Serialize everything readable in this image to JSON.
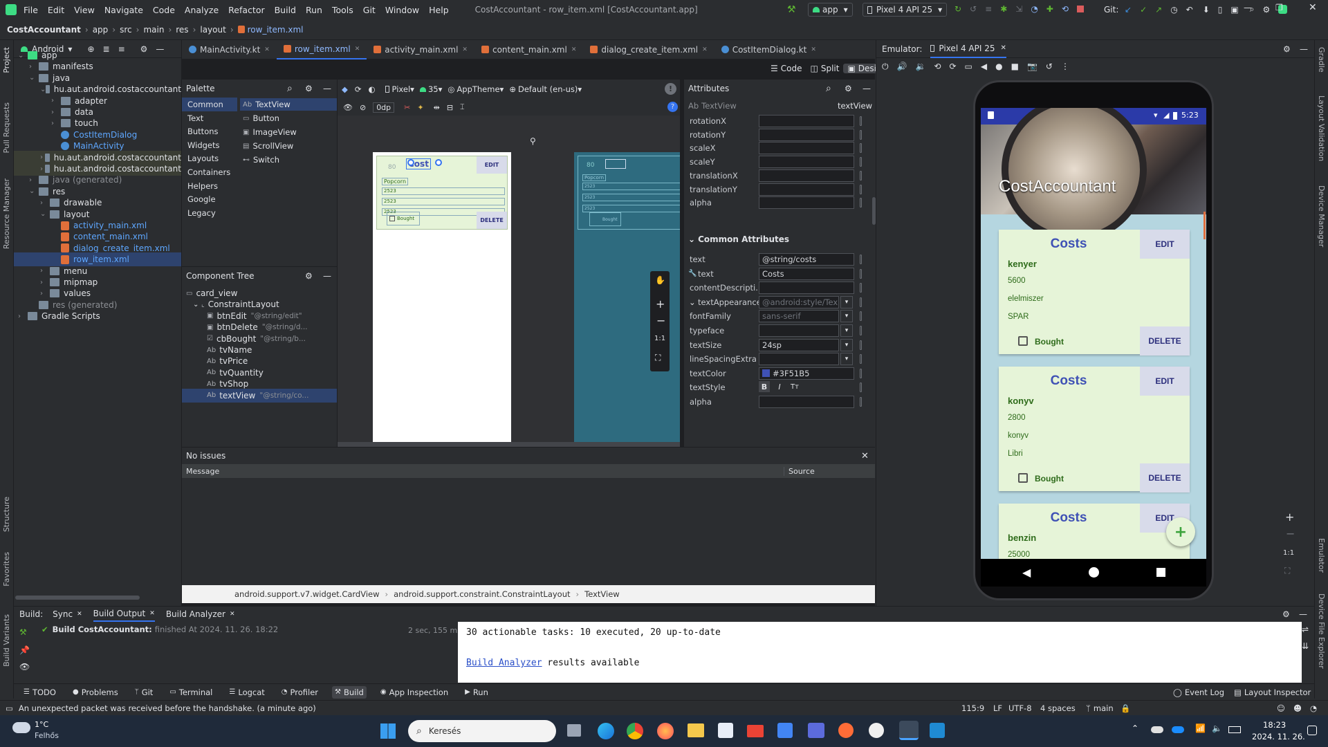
{
  "titlebar": {
    "menu": [
      "File",
      "Edit",
      "View",
      "Navigate",
      "Code",
      "Analyze",
      "Refactor",
      "Build",
      "Run",
      "Tools",
      "Git",
      "Window",
      "Help"
    ],
    "title": "CostAccountant - row_item.xml [CostAccountant.app]",
    "run_config": "app",
    "device": "Pixel 4 API 25",
    "git_label": "Git:"
  },
  "breadcrumb": [
    "CostAccountant",
    "app",
    "src",
    "main",
    "res",
    "layout",
    "row_item.xml"
  ],
  "project": {
    "view": "Android",
    "items": [
      {
        "label": "app",
        "depth": 0
      },
      {
        "label": "manifests",
        "depth": 1
      },
      {
        "label": "java",
        "depth": 1
      },
      {
        "label": "hu.aut.android.costaccountant",
        "depth": 2
      },
      {
        "label": "adapter",
        "depth": 3
      },
      {
        "label": "data",
        "depth": 3
      },
      {
        "label": "touch",
        "depth": 3
      },
      {
        "label": "CostItemDialog",
        "depth": 3
      },
      {
        "label": "MainActivity",
        "depth": 3
      },
      {
        "label": "hu.aut.android.costaccountant",
        "depth": 2
      },
      {
        "label": "hu.aut.android.costaccountant",
        "depth": 2
      },
      {
        "label": "java (generated)",
        "depth": 1
      },
      {
        "label": "res",
        "depth": 1
      },
      {
        "label": "drawable",
        "depth": 2
      },
      {
        "label": "layout",
        "depth": 2
      },
      {
        "label": "activity_main.xml",
        "depth": 3
      },
      {
        "label": "content_main.xml",
        "depth": 3
      },
      {
        "label": "dialog_create_item.xml",
        "depth": 3
      },
      {
        "label": "row_item.xml",
        "depth": 3
      },
      {
        "label": "menu",
        "depth": 2
      },
      {
        "label": "mipmap",
        "depth": 2
      },
      {
        "label": "values",
        "depth": 2
      },
      {
        "label": "res (generated)",
        "depth": 1
      },
      {
        "label": "Gradle Scripts",
        "depth": 0
      }
    ]
  },
  "tabs": [
    "MainActivity.kt",
    "row_item.xml",
    "activity_main.xml",
    "content_main.xml",
    "dialog_create_item.xml",
    "CostItemDialog.kt"
  ],
  "view_modes": [
    "Code",
    "Split",
    "Design"
  ],
  "palette": {
    "title": "Palette",
    "categories": [
      "Common",
      "Text",
      "Buttons",
      "Widgets",
      "Layouts",
      "Containers",
      "Helpers",
      "Google",
      "Legacy"
    ],
    "widgets": [
      "TextView",
      "Button",
      "ImageView",
      "ScrollView",
      "Switch"
    ]
  },
  "design_toolbar": {
    "device": "Pixel",
    "api": "35",
    "theme": "AppTheme",
    "locale": "Default (en-us)",
    "margin": "0dp"
  },
  "preview": {
    "title_text": "Cost",
    "edit": "EDIT",
    "delete": "DELETE",
    "name": "Popcorn",
    "value": "2523",
    "bought": "Bought",
    "margin_num": "80"
  },
  "component_tree": {
    "title": "Component Tree",
    "items": [
      {
        "label": "card_view",
        "hint": "",
        "depth": 0
      },
      {
        "label": "ConstraintLayout",
        "hint": "",
        "depth": 1
      },
      {
        "label": "btnEdit",
        "hint": "\"@string/edit\"",
        "depth": 2
      },
      {
        "label": "btnDelete",
        "hint": "\"@string/d...",
        "depth": 2
      },
      {
        "label": "cbBought",
        "hint": "\"@string/b...",
        "depth": 2
      },
      {
        "label": "tvName",
        "hint": "",
        "depth": 2
      },
      {
        "label": "tvPrice",
        "hint": "",
        "depth": 2
      },
      {
        "label": "tvQuantity",
        "hint": "",
        "depth": 2
      },
      {
        "label": "tvShop",
        "hint": "",
        "depth": 2
      },
      {
        "label": "textView",
        "hint": "\"@string/co...",
        "depth": 2
      }
    ]
  },
  "attributes": {
    "title": "Attributes",
    "widget": "TextView",
    "id": "textView",
    "transform": [
      {
        "k": "rotationX",
        "v": ""
      },
      {
        "k": "rotationY",
        "v": ""
      },
      {
        "k": "scaleX",
        "v": ""
      },
      {
        "k": "scaleY",
        "v": ""
      },
      {
        "k": "translationX",
        "v": ""
      },
      {
        "k": "translationY",
        "v": ""
      },
      {
        "k": "alpha",
        "v": ""
      }
    ],
    "section": "Common Attributes",
    "common": [
      {
        "k": "text",
        "v": "@string/costs"
      },
      {
        "k": "text",
        "v": "Costs"
      },
      {
        "k": "contentDescripti...",
        "v": ""
      },
      {
        "k": "textAppearance",
        "v": "@android:style/Tex"
      },
      {
        "k": "fontFamily",
        "v": "sans-serif"
      },
      {
        "k": "typeface",
        "v": ""
      },
      {
        "k": "textSize",
        "v": "24sp"
      },
      {
        "k": "lineSpacingExtra",
        "v": ""
      },
      {
        "k": "textColor",
        "v": "#3F51B5"
      },
      {
        "k": "textStyle",
        "v": ""
      },
      {
        "k": "alpha",
        "v": ""
      }
    ]
  },
  "issues": {
    "title": "No issues",
    "col_message": "Message",
    "col_source": "Source"
  },
  "design_breadcrumb": [
    "android.support.v7.widget.CardView",
    "android.support.constraint.ConstraintLayout",
    "TextView"
  ],
  "emulator": {
    "label": "Emulator:",
    "device": "Pixel 4 API 25",
    "time": "5:23",
    "app_title": "CostAccountant",
    "cards": [
      {
        "title": "Costs",
        "edit": "EDIT",
        "name": "kenyer",
        "price": "5600",
        "category": "elelmiszer",
        "shop": "SPAR",
        "bought": "Bought",
        "delete": "DELETE"
      },
      {
        "title": "Costs",
        "edit": "EDIT",
        "name": "konyv",
        "price": "2800",
        "category": "konyv",
        "shop": "Libri",
        "bought": "Bought",
        "delete": "DELETE"
      },
      {
        "title": "Costs",
        "edit": "EDIT",
        "name": "benzin",
        "price": "25000"
      }
    ],
    "fab": "+",
    "zoom": "1:1"
  },
  "build": {
    "label": "Build:",
    "tabs": [
      "Sync",
      "Build Output",
      "Build Analyzer"
    ],
    "result": "Build CostAccountant:",
    "result_rest": "finished At 2024. 11. 26. 18:22",
    "duration": "2 sec, 155 ms",
    "line1": "30 actionable tasks: 10 executed, 20 up-to-date",
    "link": "Build Analyzer",
    "link_rest": " results available"
  },
  "toolwindows": [
    "TODO",
    "Problems",
    "Git",
    "Terminal",
    "Logcat",
    "Profiler",
    "Build",
    "App Inspection",
    "Run"
  ],
  "toolwindows_right": [
    "Event Log",
    "Layout Inspector"
  ],
  "side_left": [
    "Project",
    "Pull Requests",
    "Resource Manager",
    "Structure",
    "Favorites",
    "Build Variants"
  ],
  "side_right": [
    "Gradle",
    "Layout Validation",
    "Device Manager",
    "Emulator",
    "Device File Explorer"
  ],
  "status": {
    "message": "An unexpected packet was received before the handshake. (a minute ago)",
    "pos": "115:9",
    "le": "LF",
    "enc": "UTF-8",
    "indent": "4 spaces",
    "branch": "main"
  },
  "taskbar": {
    "temp": "1°C",
    "weather": "Felhős",
    "search": "Keresés",
    "time": "18:23",
    "date": "2024. 11. 26."
  }
}
